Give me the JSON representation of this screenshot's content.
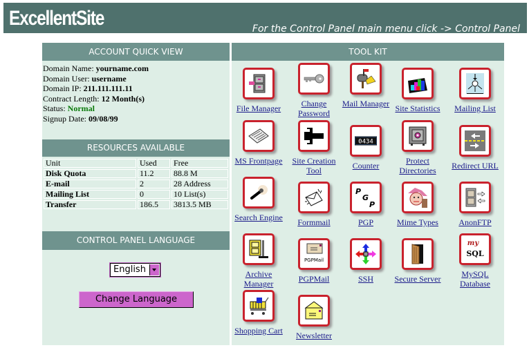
{
  "header": {
    "logo": "ExcellentSite",
    "tagline_prefix": "For the Control Panel main menu click -> ",
    "tagline_link": "Control Panel"
  },
  "account": {
    "title": "ACCOUNT QUICK VIEW",
    "rows": [
      {
        "label": "Domain Name: ",
        "value": "yourname.com"
      },
      {
        "label": "Domain User: ",
        "value": "username"
      },
      {
        "label": "Domain IP: ",
        "value": "211.111.111.11"
      },
      {
        "label": "Contract Length: ",
        "value": "12 Month(s)"
      },
      {
        "label": "Status: ",
        "value": "Normal"
      },
      {
        "label": "Signup Date: ",
        "value": "09/08/99"
      }
    ]
  },
  "resources": {
    "title": "RESOURCES AVAILABLE",
    "columns": [
      "Unit",
      "Used",
      "Free"
    ],
    "rows": [
      {
        "unit": "Disk Quota",
        "used": "11.2",
        "free": "88.8 M"
      },
      {
        "unit": "E-mail",
        "used": "2",
        "free": "28 Address"
      },
      {
        "unit": "Mailing List",
        "used": "0",
        "free": "10 List(s)"
      },
      {
        "unit": "Transfer",
        "used": "186.5",
        "free": "3813.5 MB"
      }
    ]
  },
  "language": {
    "title": "CONTROL PANEL LANGUAGE",
    "selected": "English",
    "button": "Change Language"
  },
  "toolkit": {
    "title": "TOOL KIT",
    "tools": [
      {
        "label": "File Manager",
        "icon": "file-cabinet-icon"
      },
      {
        "label": "Change Password",
        "icon": "key-icon"
      },
      {
        "label": "Mail Manager",
        "icon": "mailbox-icon"
      },
      {
        "label": "Site Statistics",
        "icon": "bar-chart-icon"
      },
      {
        "label": "Mailing List",
        "icon": "distribution-icon"
      },
      {
        "label": "MS Frontpage",
        "icon": "newspaper-icon"
      },
      {
        "label": "Site Creation Tool",
        "icon": "wrench-icon"
      },
      {
        "label": "Counter",
        "icon": "counter-icon",
        "counter_text": "0434"
      },
      {
        "label": "Protect Directories",
        "icon": "safe-icon"
      },
      {
        "label": "Redirect URL",
        "icon": "redirect-arrows-icon"
      },
      {
        "label": "Search Engine",
        "icon": "flashlight-icon"
      },
      {
        "label": "Formmail",
        "icon": "envelope-burst-icon"
      },
      {
        "label": "PGP",
        "icon": "pgp-letters-icon"
      },
      {
        "label": "Mime Types",
        "icon": "jester-icon"
      },
      {
        "label": "AnonFTP",
        "icon": "ftp-cabinet-icon"
      },
      {
        "label": "Archive Manager",
        "icon": "archive-clamp-icon"
      },
      {
        "label": "PGPMail",
        "icon": "pgp-mail-icon",
        "icon_text": "PGPMail"
      },
      {
        "label": "SSH",
        "icon": "four-arrows-icon"
      },
      {
        "label": "Secure Server",
        "icon": "door-icon"
      },
      {
        "label": "MySQL Database",
        "icon": "mysql-icon",
        "icon_text_top": "my",
        "icon_text_bottom": "SQL"
      },
      {
        "label": "Shopping Cart",
        "icon": "shopping-cart-icon"
      },
      {
        "label": "Newsletter",
        "icon": "newsletter-envelope-icon"
      }
    ]
  }
}
